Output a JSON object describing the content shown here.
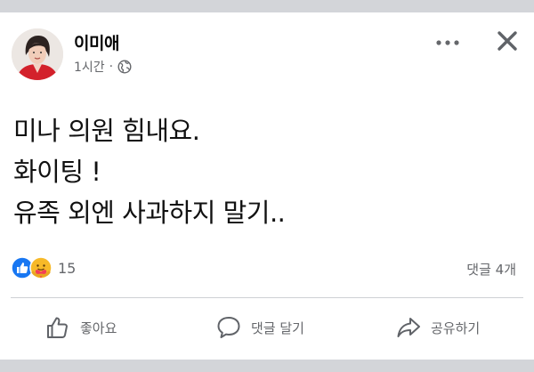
{
  "post": {
    "author": "이미애",
    "time": "1시간",
    "separator": "·",
    "lines": [
      "미나 의원 힘내요.",
      "화이팅 !",
      "유족 외엔 사과하지 말기.."
    ]
  },
  "icons": {
    "more": "more-horizontal-icon",
    "close": "close-icon",
    "privacy": "globe-icon",
    "like": "like-icon",
    "comment": "comment-icon",
    "share": "share-icon"
  },
  "reactions": {
    "count": "15",
    "types": [
      "like",
      "care"
    ]
  },
  "comments": {
    "count_label": "댓글 4개"
  },
  "actions": {
    "like_label": "좋아요",
    "comment_label": "댓글 달기",
    "share_label": "공유하기"
  },
  "colors": {
    "like_blue": "#1877f2",
    "care_yellow": "#f7b928",
    "muted_text": "#65676b",
    "page_background": "#d3d5d9"
  }
}
